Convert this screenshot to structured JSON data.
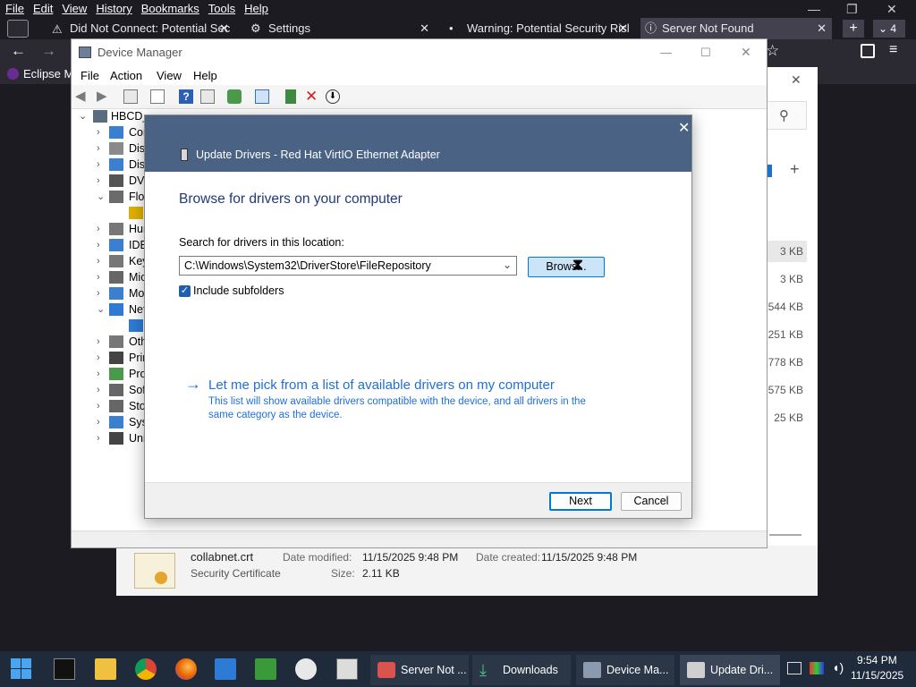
{
  "firefox": {
    "menu": [
      "File",
      "Edit",
      "View",
      "History",
      "Bookmarks",
      "Tools",
      "Help"
    ],
    "tabs": [
      {
        "label": "Did Not Connect: Potential Sec"
      },
      {
        "label": "Settings"
      },
      {
        "label": "Warning: Potential Security Risl"
      },
      {
        "label": "Server Not Found"
      }
    ],
    "tab_count": "4",
    "bookmark": "Eclipse M"
  },
  "explorer": {
    "sizes": [
      "3 KB",
      "3 KB",
      "544 KB",
      "251 KB",
      "778 KB",
      "575 KB",
      "25 KB"
    ],
    "details": {
      "name": "collabnet.crt",
      "type": "Security Certificate",
      "modified_label": "Date modified:",
      "modified": "11/15/2025 9:48 PM",
      "created_label": "Date created:",
      "created": "11/15/2025 9:48 PM",
      "size_label": "Size:",
      "size": "2.11 KB"
    }
  },
  "devmgr": {
    "title": "Device Manager",
    "menu": [
      "File",
      "Action",
      "View",
      "Help"
    ],
    "root": "HBCD_",
    "tree": [
      "Cor",
      "Disk",
      "Disp",
      "DVD",
      "Flop",
      "",
      "Hum",
      "IDE",
      "Key",
      "Mic",
      "Mo",
      "Net",
      "",
      "Oth",
      "Prin",
      "Pro",
      "Soft",
      "Stor",
      "Syst",
      "Univ"
    ]
  },
  "dialog": {
    "title": "Update Drivers - Red Hat VirtIO Ethernet Adapter",
    "heading": "Browse for drivers on your computer",
    "search_label": "Search for drivers in this location:",
    "path": "C:\\Windows\\System32\\DriverStore\\FileRepository",
    "browse": "Brows...",
    "include_subfolders": "Include subfolders",
    "include_checked": true,
    "pick_link": "Let me pick from a list of available drivers on my computer",
    "pick_desc": "This list will show available drivers compatible with the device, and all drivers in the same category as the device.",
    "next": "Next",
    "cancel": "Cancel"
  },
  "taskbar": {
    "apps": [
      {
        "label": "Server Not ..."
      },
      {
        "label": "Downloads"
      },
      {
        "label": "Device Ma..."
      },
      {
        "label": "Update Dri..."
      }
    ],
    "time": "9:54 PM",
    "date": "11/15/2025"
  },
  "colors": {
    "dialog_header": "#4a6283",
    "link": "#1e6fd9",
    "heading": "#1e3a7a",
    "taskbar": "#1f2a3a"
  }
}
